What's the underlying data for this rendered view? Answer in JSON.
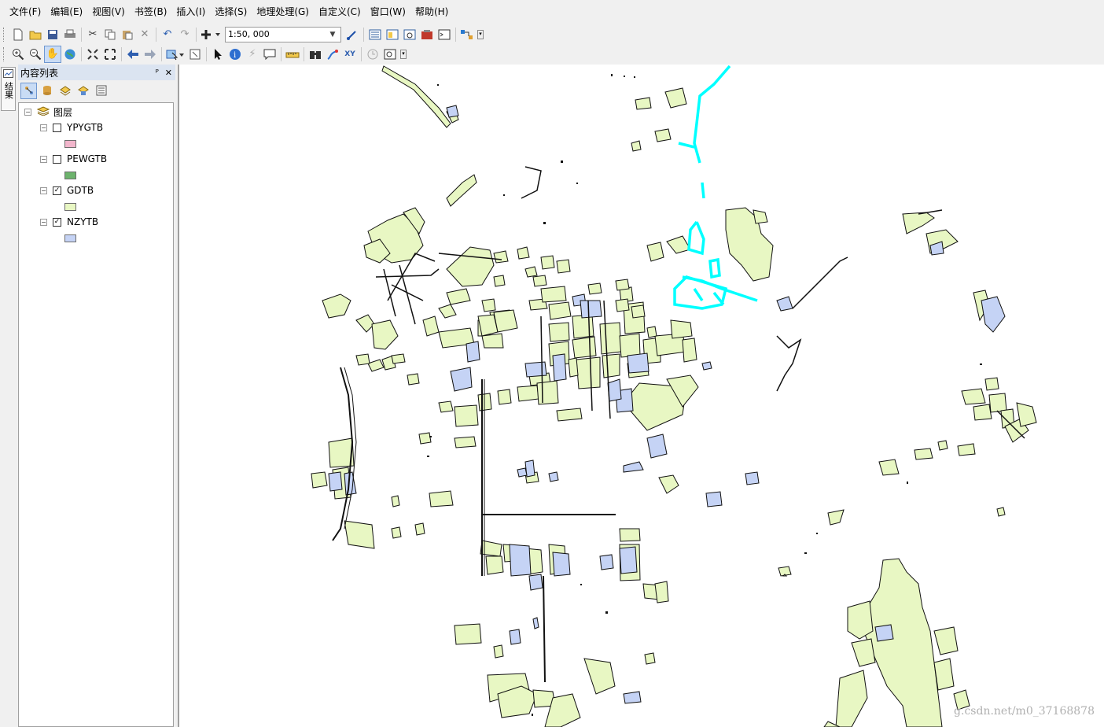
{
  "menu": [
    "文件(F)",
    "编辑(E)",
    "视图(V)",
    "书签(B)",
    "插入(I)",
    "选择(S)",
    "地理处理(G)",
    "自定义(C)",
    "窗口(W)",
    "帮助(H)"
  ],
  "toolbar": {
    "scale_value": "1:50, 000"
  },
  "side_tab": {
    "label": "结果"
  },
  "toc": {
    "title": "内容列表",
    "root_label": "图层",
    "layers": [
      {
        "name": "YPYGTB",
        "checked": false,
        "color": "#f2b6cc"
      },
      {
        "name": "PEWGTB",
        "checked": false,
        "color": "#6db36d"
      },
      {
        "name": "GDTB",
        "checked": true,
        "color": "#e8f7c3"
      },
      {
        "name": "NZYTB",
        "checked": true,
        "color": "#c5d3f5"
      }
    ]
  },
  "map": {
    "colors": {
      "gdtb_fill": "#e8f7c3",
      "nzytb_fill": "#c5d3f5",
      "outline": "#111111",
      "highlight": "#00ffff"
    }
  },
  "watermark": "g.csdn.net/m0_37168878"
}
